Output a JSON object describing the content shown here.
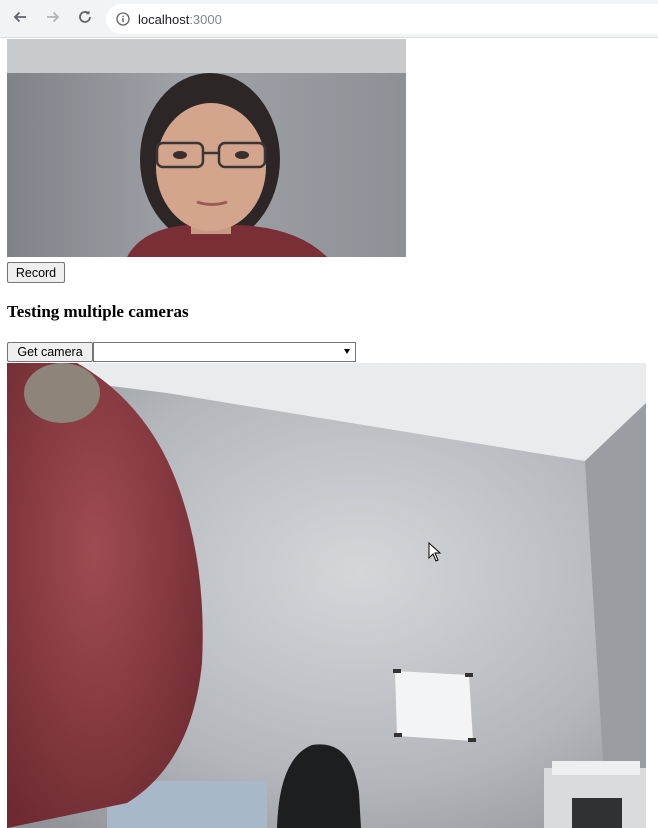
{
  "browser": {
    "url_host": "localhost",
    "url_port": ":3000",
    "icons": {
      "back": "arrow-left-icon",
      "forward": "arrow-right-icon",
      "reload": "reload-icon",
      "site_info": "info-icon"
    }
  },
  "page": {
    "record_label": "Record",
    "heading": "Testing multiple cameras",
    "get_camera_label": "Get camera",
    "camera_select_value": ""
  },
  "colors": {
    "chrome_bg": "#f1f3f4",
    "wall": "#b4b8bc",
    "sweater": "#8f3d44"
  }
}
